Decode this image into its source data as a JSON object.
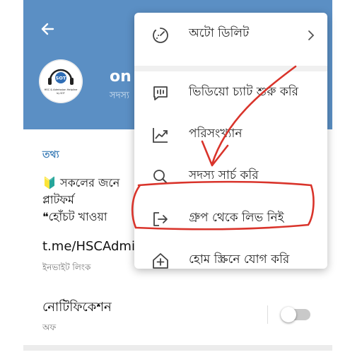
{
  "header": {
    "group_name": "on h",
    "group_sub": "সদস্য"
  },
  "info": {
    "section_title": "তথ্য",
    "desc_line1": "🔰 সকলের জনে",
    "desc_line2": "প্লাটফর্ম",
    "desc_line3": "❝হোঁচট খাওয়া",
    "link": "t.me/HSCAdmi",
    "link_sub": "ইনভাইট লিংক"
  },
  "notifications": {
    "label": "নোটিফিকেশন",
    "status": "অফ",
    "enabled": false
  },
  "avatar": {
    "logo_text": "HSC & Admission Helpline",
    "logo_sub": "by SOT",
    "badge": "SOT"
  },
  "menu": {
    "items": [
      {
        "label": "অটো ডিলিট",
        "icon": "timer-icon"
      },
      {
        "label": "ভিডিয়ো চ্যাট শুরু করি",
        "icon": "video-chat-icon"
      },
      {
        "label": "পরিসংখ্যান",
        "icon": "statistics-icon"
      },
      {
        "label": "সদস্য সার্চ করি",
        "icon": "search-icon"
      },
      {
        "label": "গ্রুপ থেকে লিভ নিই",
        "icon": "leave-icon"
      },
      {
        "label": "হোম স্ক্রিনে যোগ করি",
        "icon": "add-home-icon"
      }
    ]
  },
  "colors": {
    "header_bg": "#5b8fc4",
    "accent": "#3f7fb8",
    "annotation": "#d9342b"
  }
}
